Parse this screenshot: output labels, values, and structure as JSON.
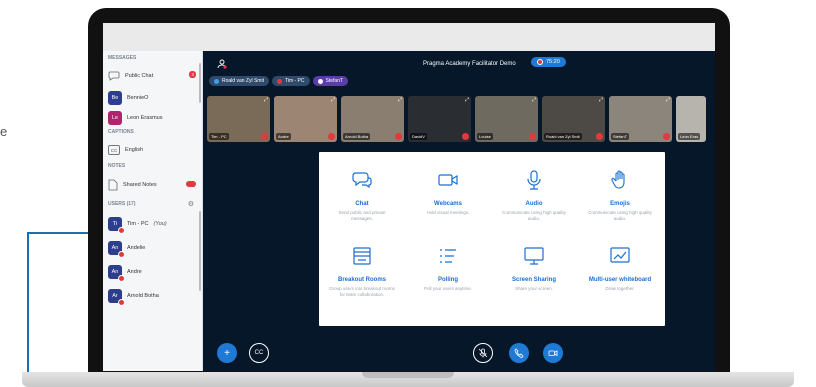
{
  "stray_text": "e",
  "app": {
    "title": "Pragma Academy Facilitator Demo",
    "timer": "75:20"
  },
  "sidebar": {
    "messages_header": "MESSAGES",
    "public_chat": "Public Chat",
    "public_chat_badge": "3",
    "chat_users": [
      {
        "initials": "Be",
        "name": "BennieO",
        "color": "#2c3e8c"
      },
      {
        "initials": "Le",
        "name": "Leon Erasmus",
        "color": "#b0246c"
      }
    ],
    "captions_header": "CAPTIONS",
    "caption_icon": "CC",
    "caption_lang": "English",
    "notes_header": "NOTES",
    "shared_notes": "Shared Notes",
    "users_header": "USERS (17)",
    "users": [
      {
        "initials": "Ti",
        "name": "Tim - PC",
        "you": "(You)",
        "color": "#2c3e8c"
      },
      {
        "initials": "An",
        "name": "Andelie",
        "color": "#2c3e8c"
      },
      {
        "initials": "An",
        "name": "Andre",
        "color": "#2c3e8c"
      },
      {
        "initials": "Ar",
        "name": "Arnold Botha",
        "color": "#2c3e8c"
      }
    ]
  },
  "pills": [
    {
      "label": "Roald van Zyl Smit",
      "color": "#2f4a6b"
    },
    {
      "label": "Tim - PC",
      "color": "#2f4a6b"
    },
    {
      "label": "StefanT",
      "color": "#5b3da8"
    }
  ],
  "webcams": [
    {
      "name": "Tim - PC",
      "bg": "#7a6a58"
    },
    {
      "name": "Andre",
      "bg": "#9c8673"
    },
    {
      "name": "Arnold Botha",
      "bg": "#8a7e70"
    },
    {
      "name": "DavidV",
      "bg": "#2a2e33"
    },
    {
      "name": "Louise",
      "bg": "#6f6a60"
    },
    {
      "name": "Roald van Zyl Smit",
      "bg": "#4d4a46"
    },
    {
      "name": "StefanT",
      "bg": "#8b857b"
    },
    {
      "name": "Leon Eras",
      "bg": "#b7b3ad"
    }
  ],
  "features": [
    {
      "icon": "chat-icon",
      "name": "Chat",
      "desc": "Send public and private messages."
    },
    {
      "icon": "webcam-icon",
      "name": "Webcams",
      "desc": "Hold visual meetings."
    },
    {
      "icon": "microphone-icon",
      "name": "Audio",
      "desc": "Communicate using high quality audio."
    },
    {
      "icon": "hand-icon",
      "name": "Emojis",
      "desc": "Communicate using high quality audio."
    },
    {
      "icon": "breakout-icon",
      "name": "Breakout Rooms",
      "desc": "Group users into breakout rooms for team collaboration."
    },
    {
      "icon": "polling-icon",
      "name": "Polling",
      "desc": "Poll your users anytime."
    },
    {
      "icon": "monitor-icon",
      "name": "Screen Sharing",
      "desc": "Share your screen."
    },
    {
      "icon": "whiteboard-icon",
      "name": "Multi-user whiteboard",
      "desc": "Draw together."
    }
  ],
  "colors": {
    "accent": "#1f7ad6",
    "bg": "#06172a",
    "alert": "#e0393e"
  }
}
